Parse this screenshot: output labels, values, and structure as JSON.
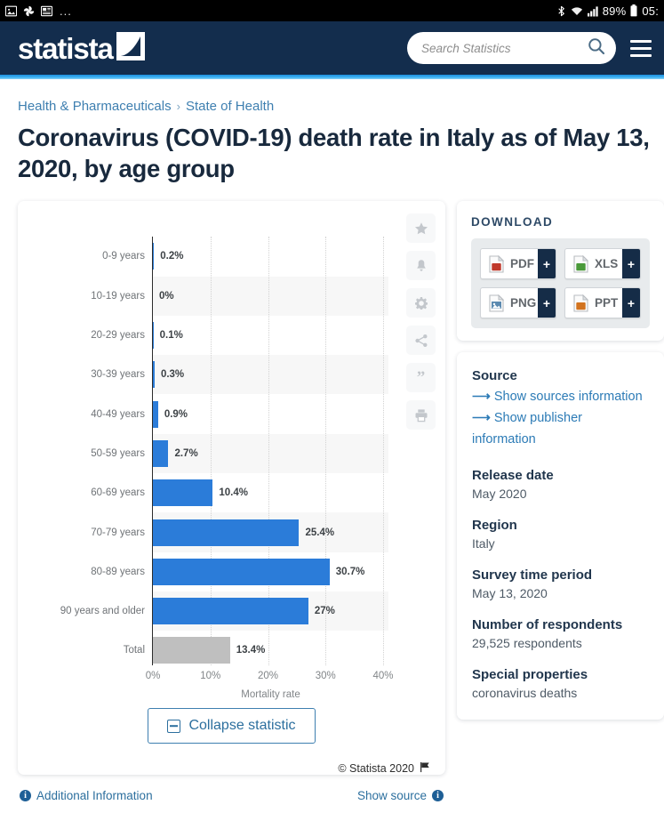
{
  "statusbar": {
    "left_icons": [
      "image-icon",
      "photos-icon",
      "news-icon"
    ],
    "overflow": "...",
    "bluetooth_icon": "bluetooth-icon",
    "wifi_icon": "wifi-icon",
    "signal_icon": "signal-icon",
    "battery_percent": "89%",
    "battery_icon": "battery-icon",
    "time": "05:"
  },
  "header": {
    "logo_text": "statista",
    "logo_mark": "statista-logo-mark",
    "search_placeholder": "Search Statistics",
    "search_value": "",
    "search_icon": "search-icon",
    "menu_icon": "hamburger-menu-icon",
    "bg_color": "#132d4d",
    "accent_color": "#3fb3f2"
  },
  "breadcrumb": {
    "items": [
      "Health & Pharmaceuticals",
      "State of Health"
    ],
    "separator": "›"
  },
  "title": {
    "line1": "Coronavirus (COVID-19) death rate in Italy as of May 13,",
    "line2": "2020, by age group"
  },
  "rail": {
    "buttons": [
      {
        "name": "favorite-star-icon"
      },
      {
        "name": "notification-bell-icon"
      },
      {
        "name": "settings-gear-icon"
      },
      {
        "name": "share-icon"
      },
      {
        "name": "cite-quote-icon",
        "glyph": "”"
      },
      {
        "name": "print-icon"
      }
    ]
  },
  "chart_data": {
    "type": "bar",
    "orientation": "horizontal",
    "title": "",
    "xlabel": "Mortality rate",
    "ylabel": "",
    "xlim": [
      0,
      40
    ],
    "xticks": [
      "0%",
      "10%",
      "20%",
      "30%",
      "40%"
    ],
    "xtick_values": [
      0,
      10,
      20,
      30,
      40
    ],
    "grid": "vertical-dotted",
    "legend": "none",
    "bar_color": "#2b7cd9",
    "total_bar_color": "#bfbfbf",
    "categories": [
      "0-9 years",
      "10-19 years",
      "20-29 years",
      "30-39 years",
      "40-49 years",
      "50-59 years",
      "60-69 years",
      "70-79 years",
      "80-89 years",
      "90 years and older",
      "Total"
    ],
    "values": [
      0.2,
      0,
      0.1,
      0.3,
      0.9,
      2.7,
      10.4,
      25.4,
      30.7,
      27,
      13.4
    ],
    "labels": [
      "0.2%",
      "0%",
      "0.1%",
      "0.3%",
      "0.9%",
      "2.7%",
      "10.4%",
      "25.4%",
      "30.7%",
      "27%",
      "13.4%"
    ]
  },
  "collapse": {
    "label": "Collapse statistic",
    "icon": "minus-box-icon"
  },
  "copyright": {
    "text": "© Statista 2020",
    "flag_icon": "flag-icon"
  },
  "card_footer": {
    "additional_info": "Additional Information",
    "show_source": "Show source",
    "info_icon": "info-icon"
  },
  "download": {
    "title": "DOWNLOAD",
    "buttons": [
      {
        "label": "PDF",
        "icon": "pdf-file-icon",
        "plus": "+",
        "color": "#c0392b"
      },
      {
        "label": "XLS",
        "icon": "xls-file-icon",
        "plus": "+",
        "color": "#4a9a3a"
      },
      {
        "label": "PNG",
        "icon": "png-file-icon",
        "plus": "+",
        "color": "#5b8ab0"
      },
      {
        "label": "PPT",
        "icon": "ppt-file-icon",
        "plus": "+",
        "color": "#d2731f"
      }
    ]
  },
  "info": {
    "source_heading": "Source",
    "source_links": [
      "Show sources information",
      "Show publisher information"
    ],
    "fields": [
      {
        "heading": "Release date",
        "value": "May 2020"
      },
      {
        "heading": "Region",
        "value": "Italy"
      },
      {
        "heading": "Survey time period",
        "value": "May 13, 2020"
      },
      {
        "heading": "Number of respondents",
        "value": "29,525 respondents"
      },
      {
        "heading": "Special properties",
        "value": "coronavirus deaths"
      }
    ]
  }
}
